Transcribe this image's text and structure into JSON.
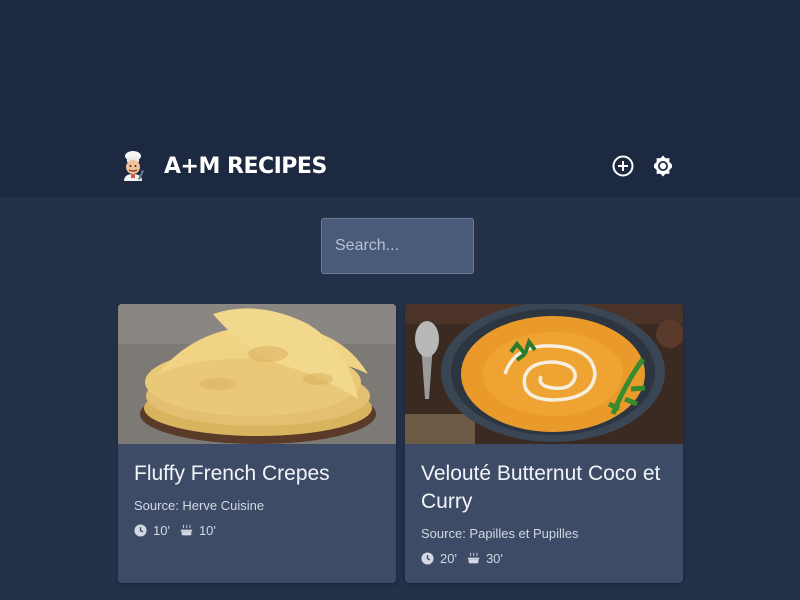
{
  "header": {
    "title": "A+M RECIPES",
    "logo_icon": "chef-icon",
    "add_icon": "add-circle-icon",
    "theme_icon": "theme-toggle-icon"
  },
  "search": {
    "placeholder": "Search..."
  },
  "recipes": [
    {
      "title": "Fluffy French Crepes",
      "source": "Source: Herve Cuisine",
      "prep_time": "10'",
      "cook_time": "10'",
      "image": "crepes-photo"
    },
    {
      "title": "Velouté Butternut Coco et Curry",
      "source": "Source: Papilles et Pupilles",
      "prep_time": "20'",
      "cook_time": "30'",
      "image": "butternut-soup-photo"
    }
  ],
  "colors": {
    "header_bg": "#1d2841",
    "page_bg": "#243149",
    "card_bg": "#3d4b66",
    "search_bg": "#4a5b7a"
  }
}
